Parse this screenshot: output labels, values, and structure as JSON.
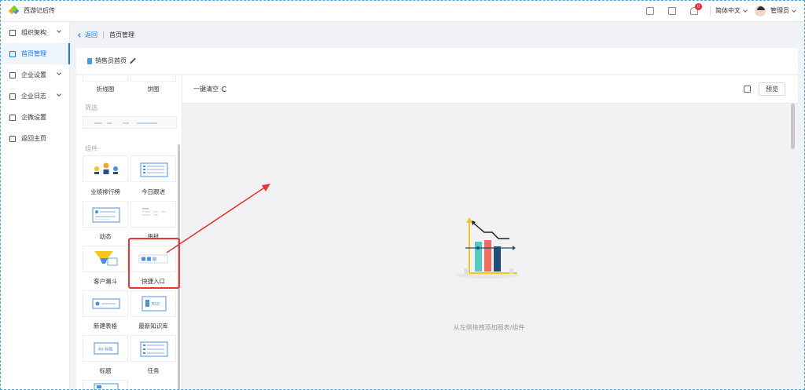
{
  "app": {
    "name": "西游记后传"
  },
  "topbar": {
    "notification_count": "0",
    "language": "简体中文",
    "user": "管理员"
  },
  "sidebar": {
    "items": [
      {
        "label": "组织架构",
        "expandable": true,
        "active": false
      },
      {
        "label": "首页管理",
        "expandable": false,
        "active": true
      },
      {
        "label": "企业设置",
        "expandable": true,
        "active": false
      },
      {
        "label": "企业日志",
        "expandable": true,
        "active": false
      },
      {
        "label": "企微设置",
        "expandable": false,
        "active": false
      },
      {
        "label": "返回主页",
        "expandable": false,
        "active": false
      }
    ]
  },
  "breadcrumb": {
    "back": "返回",
    "current": "首页管理"
  },
  "page": {
    "title": "销售员首页"
  },
  "components": {
    "top_labels": [
      "折线图",
      "饼图"
    ],
    "filter_section": "筛选",
    "widget_section": "组件",
    "items": [
      {
        "label": "业绩排行榜"
      },
      {
        "label": "今日跟进"
      },
      {
        "label": "动态"
      },
      {
        "label": "审批"
      },
      {
        "label": "客户漏斗"
      },
      {
        "label": "快捷入口"
      },
      {
        "label": "新建表格"
      },
      {
        "label": "最新知识库"
      },
      {
        "label": "标题"
      },
      {
        "label": "任务"
      }
    ],
    "thumb_text": {
      "knowledge": "知识",
      "title": "Aa 标题"
    }
  },
  "canvas": {
    "clear_label": "一键清空",
    "preview_label": "预览",
    "empty_hint": "从左侧拖拽添加图表/组件"
  },
  "colors": {
    "accent": "#1677ff",
    "highlight": "#e53935",
    "bar_teal": "#4ecdc4",
    "bar_red": "#f26b5b",
    "bar_navy": "#1f4e79",
    "axis_yellow": "#f5c518"
  }
}
